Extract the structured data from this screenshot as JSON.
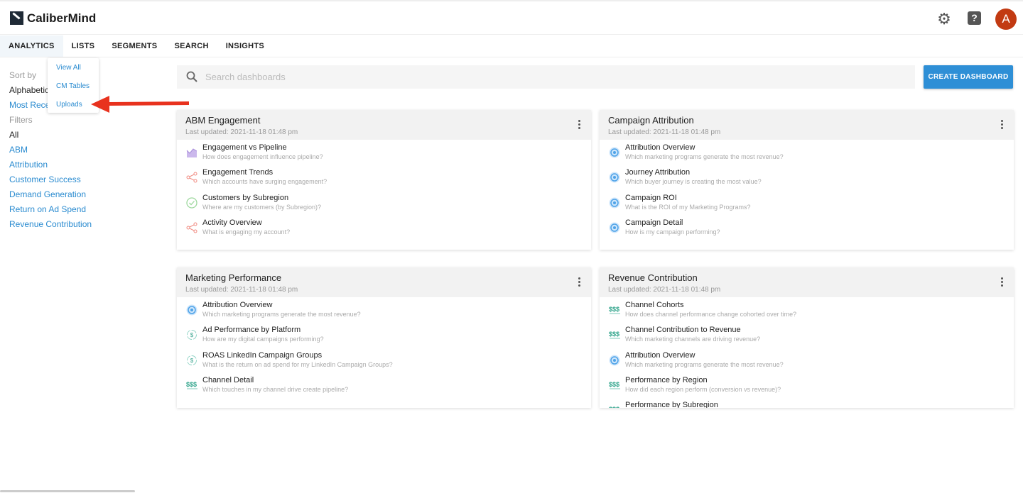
{
  "app": {
    "brand": "CaliberMind",
    "avatar_letter": "A",
    "help_glyph": "?"
  },
  "nav": {
    "tabs": [
      {
        "label": "ANALYTICS",
        "active": true
      },
      {
        "label": "LISTS"
      },
      {
        "label": "SEGMENTS"
      },
      {
        "label": "SEARCH"
      },
      {
        "label": "INSIGHTS"
      }
    ]
  },
  "dropdown": {
    "items": [
      "View All",
      "CM Tables",
      "Uploads"
    ]
  },
  "sidebar": {
    "sort_label": "Sort by",
    "sort_options": [
      "Alphabetical",
      "Most Recent"
    ],
    "filters_label": "Filters",
    "filters": [
      "All",
      "ABM",
      "Attribution",
      "Customer Success",
      "Demand Generation",
      "Return on Ad Spend",
      "Revenue Contribution"
    ]
  },
  "search": {
    "placeholder": "Search dashboards",
    "value": ""
  },
  "create_button": "CREATE DASHBOARD",
  "colors": {
    "accent": "#2e8fd6",
    "link": "#2a8bd0",
    "avatar": "#c23a12",
    "annotation_arrow": "#e8321e"
  },
  "cards": [
    {
      "title": "ABM Engagement",
      "updated": "Last updated: 2021-11-18 01:48 pm",
      "items": [
        {
          "icon": "area-chart",
          "title": "Engagement vs Pipeline",
          "subtitle": "How does engagement influence pipeline?"
        },
        {
          "icon": "share-nodes",
          "title": "Engagement Trends",
          "subtitle": "Which accounts have surging engagement?"
        },
        {
          "icon": "check-circle",
          "title": "Customers by Subregion",
          "subtitle": "Where are my customers (by Subregion)?"
        },
        {
          "icon": "share-nodes",
          "title": "Activity Overview",
          "subtitle": "What is engaging my account?"
        }
      ]
    },
    {
      "title": "Campaign Attribution",
      "updated": "Last updated: 2021-11-18 01:48 pm",
      "items": [
        {
          "icon": "target",
          "title": "Attribution Overview",
          "subtitle": "Which marketing programs generate the most revenue?"
        },
        {
          "icon": "target",
          "title": "Journey Attribution",
          "subtitle": "Which buyer journey is creating the most value?"
        },
        {
          "icon": "target",
          "title": "Campaign ROI",
          "subtitle": "What is the ROI of my Marketing Programs?"
        },
        {
          "icon": "target",
          "title": "Campaign Detail",
          "subtitle": "How is my campaign performing?"
        }
      ]
    },
    {
      "title": "Marketing Performance",
      "updated": "Last updated: 2021-11-18 01:48 pm",
      "items": [
        {
          "icon": "target",
          "title": "Attribution Overview",
          "subtitle": "Which marketing programs generate the most revenue?"
        },
        {
          "icon": "dollar-cycle",
          "title": "Ad Performance by Platform",
          "subtitle": "How are my digital campaigns performing?"
        },
        {
          "icon": "dollar-cycle",
          "title": "ROAS LinkedIn Campaign Groups",
          "subtitle": "What is the return on ad spend for my LinkedIn Campaign Groups?"
        },
        {
          "icon": "dollar-signs",
          "title": "Channel Detail",
          "subtitle": "Which touches in my channel drive create pipeline?"
        }
      ]
    },
    {
      "title": "Revenue Contribution",
      "updated": "Last updated: 2021-11-18 01:48 pm",
      "items": [
        {
          "icon": "dollar-signs",
          "title": "Channel Cohorts",
          "subtitle": "How does channel performance change cohorted over time?"
        },
        {
          "icon": "dollar-signs",
          "title": "Channel Contribution to Revenue",
          "subtitle": "Which marketing channels are driving revenue?"
        },
        {
          "icon": "target",
          "title": "Attribution Overview",
          "subtitle": "Which marketing programs generate the most revenue?"
        },
        {
          "icon": "dollar-signs",
          "title": "Performance by Region",
          "subtitle": "How did each region perform (conversion vs revenue)?"
        },
        {
          "icon": "dollar-signs",
          "title": "Performance by Subregion",
          "subtitle": ""
        }
      ]
    }
  ]
}
